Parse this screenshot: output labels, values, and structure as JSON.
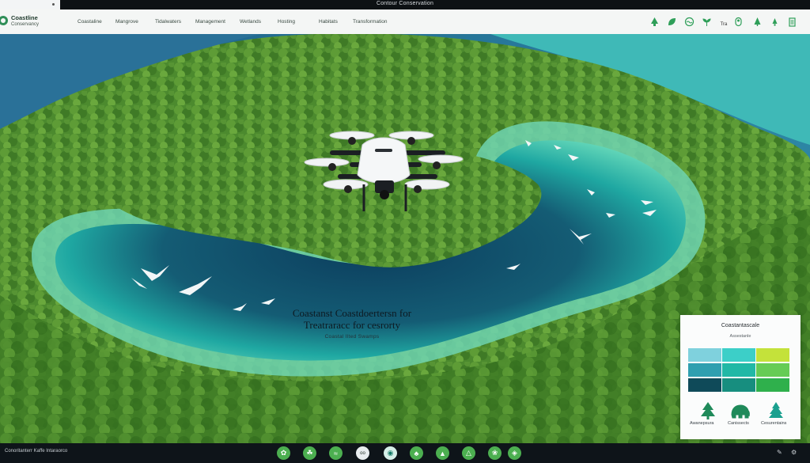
{
  "topbar": {
    "title": "Contour Conservation"
  },
  "brand": {
    "name": "Coastline",
    "tagline": "Conservancy"
  },
  "nav": {
    "links": [
      "Coastaline",
      "Mangrove",
      "Tidalwaters",
      "Management",
      "Wetlands",
      "Hosting",
      "Habitats",
      "Transformation"
    ]
  },
  "nav_icons": [
    "tree-icon",
    "leaf-icon",
    "wave-icon",
    "sprout-icon",
    "info-icon",
    "pin-icon",
    "forest-icon",
    "menu-icon"
  ],
  "nav_small_text": "Tra",
  "overlay": {
    "line1": "Coastanst Coastdoertersn for",
    "line2": "Treatraracc for cesrorty",
    "sub": "Coastal Ilted Swamps"
  },
  "legend": {
    "title": "Coastantascale",
    "subtitle": "Assestanle",
    "colors": [
      "#7fd1dd",
      "#3ccfc8",
      "#c4e23a",
      "#2f9fb0",
      "#21b8a6",
      "#66cc55",
      "#0f4a59",
      "#178e7f",
      "#2fb04c"
    ],
    "species": [
      {
        "icon": "conifer-icon",
        "label": "Awanepsura"
      },
      {
        "icon": "elephant-icon",
        "label": "Canissects"
      },
      {
        "icon": "tree-icon",
        "label": "Cesurentains"
      }
    ]
  },
  "bottombar": {
    "left_text": "Conoritanterr Kaffe Intaraorco",
    "icons": [
      "leaf-icon",
      "sprout-icon",
      "wave-icon",
      "binoculars-icon",
      "globe-icon",
      "plant-icon",
      "tree-icon",
      "forest-icon",
      "eco-icon"
    ],
    "right_icons": [
      "attach-icon",
      "settings-icon"
    ]
  },
  "colors": {
    "water_deep": "#0f4a6a",
    "water_lagoon": "#27c3b1",
    "forest": "#4e8a2f",
    "accent": "#2f9f59"
  }
}
